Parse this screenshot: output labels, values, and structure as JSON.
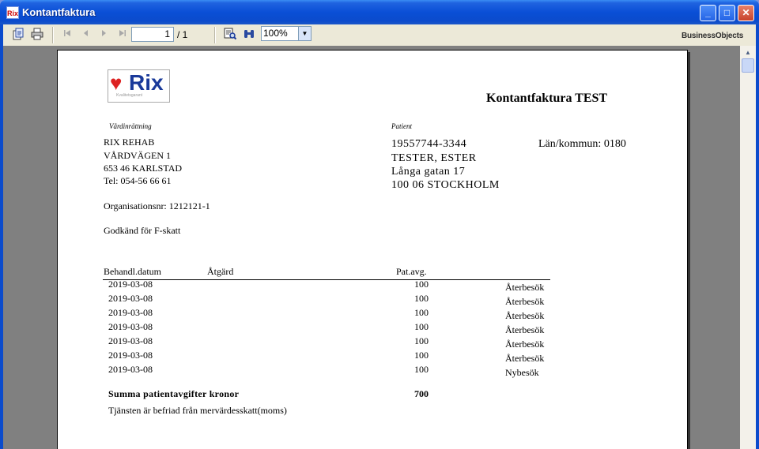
{
  "window": {
    "title": "Kontantfaktura",
    "app_icon_text": "Rix",
    "min_label": "_",
    "max_label": "□",
    "close_label": "✕"
  },
  "toolbar": {
    "page_current": "1",
    "page_total": "/ 1",
    "zoom": "100%",
    "brand": "BusinessObjects",
    "icons": [
      "export-icon",
      "print-icon",
      "first-page-icon",
      "prev-page-icon",
      "next-page-icon",
      "last-page-icon",
      "search-text-icon",
      "binoculars-icon",
      "dropdown-arrow-icon"
    ]
  },
  "logo": {
    "text": "Rix",
    "tagline": "Kvalitetsgarant"
  },
  "invoice": {
    "title": "Kontantfaktura TEST",
    "provider_label": "Vårdinrättning",
    "provider_lines": [
      "RIX REHAB",
      "VÅRDVÄGEN 1",
      "653 46  KARLSTAD",
      "Tel: 054-56 66 61"
    ],
    "org_nr": "Organisationsnr: 1212121-1",
    "ftax": "Godkänd för F-skatt",
    "patient_label": "Patient",
    "patient_lines": [
      "19557744-3344",
      "TESTER, ESTER",
      "Långa gatan 17",
      "100 06 STOCKHOLM"
    ],
    "lan_kommun": "Län/kommun: 0180",
    "columns": {
      "date": "Behandl.datum",
      "action": "Åtgärd",
      "fee": "Pat.avg."
    },
    "rows": [
      {
        "date": "2019-03-08",
        "fee": "100",
        "type": "Återbesök"
      },
      {
        "date": "2019-03-08",
        "fee": "100",
        "type": "Återbesök"
      },
      {
        "date": "2019-03-08",
        "fee": "100",
        "type": "Återbesök"
      },
      {
        "date": "2019-03-08",
        "fee": "100",
        "type": "Återbesök"
      },
      {
        "date": "2019-03-08",
        "fee": "100",
        "type": "Återbesök"
      },
      {
        "date": "2019-03-08",
        "fee": "100",
        "type": "Återbesök"
      },
      {
        "date": "2019-03-08",
        "fee": "100",
        "type": "Nybesök"
      }
    ],
    "sum_label": "Summa patientavgifter kronor",
    "sum_value": "700",
    "vat_note": "Tjänsten är befriad från mervärdesskatt(moms)"
  }
}
